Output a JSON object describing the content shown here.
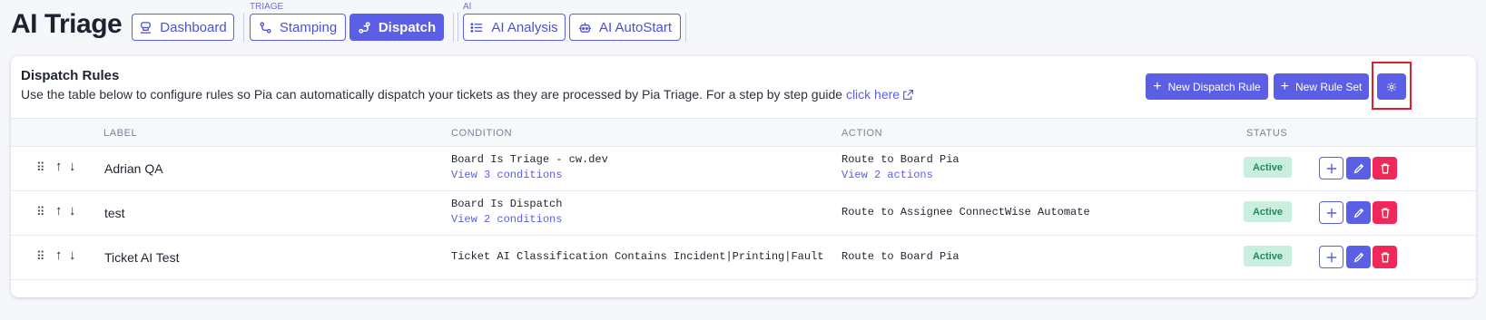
{
  "page": {
    "title": "AI Triage"
  },
  "nav": {
    "dashboard": "Dashboard",
    "triage_group": "TRIAGE",
    "stamping": "Stamping",
    "dispatch": "Dispatch",
    "ai_group": "AI",
    "ai_analysis": "AI Analysis",
    "ai_autostart": "AI AutoStart"
  },
  "card": {
    "title": "Dispatch Rules",
    "description": "Use the table below to configure rules so Pia can automatically dispatch your tickets as they are processed by Pia Triage. For a step by step guide ",
    "guide_link": "click here",
    "new_rule_button": "New Dispatch Rule",
    "new_ruleset_button": "New Rule Set"
  },
  "table": {
    "columns": {
      "label": "LABEL",
      "condition": "CONDITION",
      "action": "ACTION",
      "status": "STATUS"
    },
    "rows": [
      {
        "label": "Adrian QA",
        "condition": "Board Is Triage - cw.dev",
        "condition_link": "View 3 conditions",
        "action": "Route to Board Pia",
        "action_link": "View 2 actions",
        "status": "Active"
      },
      {
        "label": "test",
        "condition": "Board Is Dispatch",
        "condition_link": "View 2 conditions",
        "action": "Route to Assignee ConnectWise Automate",
        "status": "Active"
      },
      {
        "label": "Ticket AI Test",
        "condition": "Ticket AI Classification Contains Incident|Printing|Fault",
        "action": "Route to Board Pia",
        "status": "Active"
      }
    ]
  },
  "colors": {
    "accent": "#5b5fe6",
    "danger": "#f0285a",
    "status_active_bg": "#c9efde",
    "status_active_text": "#1f8a5c",
    "highlight": "#e11d2e"
  },
  "icons": [
    "dashboard-icon",
    "route-icon",
    "dispatch-icon",
    "list-icon",
    "robot-icon",
    "external-link-icon",
    "plus-icon",
    "gear-icon",
    "drag-handle-icon",
    "arrow-up-icon",
    "arrow-down-icon",
    "pencil-icon",
    "trash-icon"
  ]
}
